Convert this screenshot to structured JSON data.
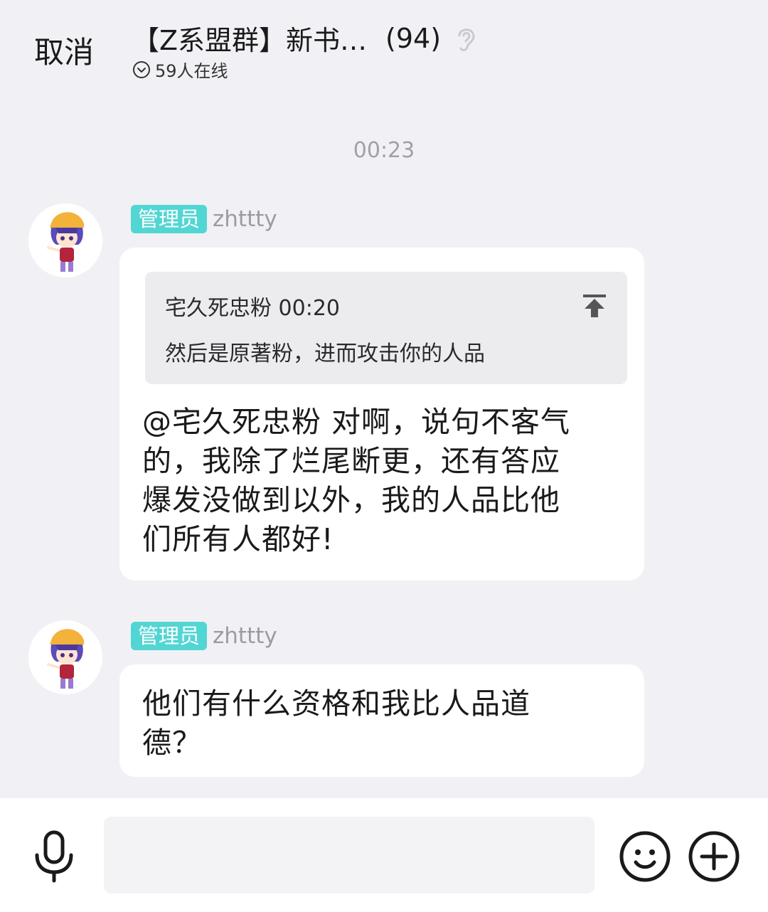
{
  "header": {
    "cancel_label": "取消",
    "group_title": "【Z系盟群】新书…",
    "member_count": "(94)",
    "online_text": "59人在线"
  },
  "timestamp": "00:23",
  "messages": [
    {
      "role": "管理员",
      "sender": "zhttty",
      "quote": {
        "header": "宅久死忠粉 00:20",
        "text": "然后是原著粉，进而攻击你的人品"
      },
      "lines": [
        "@宅久死忠粉 对啊，说句不客气",
        "的，我除了烂尾断更，还有答应",
        "爆发没做到以外，我的人品比他",
        "们所有人都好!"
      ]
    },
    {
      "role": "管理员",
      "sender": "zhttty",
      "lines": [
        "他们有什么资格和我比人品道",
        "德？"
      ]
    }
  ],
  "icons": {
    "ear": "ear-icon",
    "online": "chevron-circle-icon",
    "pin": "pin-top-icon",
    "mic": "microphone-icon",
    "emoji": "smiley-icon",
    "plus": "plus-circle-icon"
  },
  "colors": {
    "background": "#f1f1f5",
    "badge": "#52d6d4",
    "bubble": "#ffffff",
    "quote": "#ececef"
  }
}
